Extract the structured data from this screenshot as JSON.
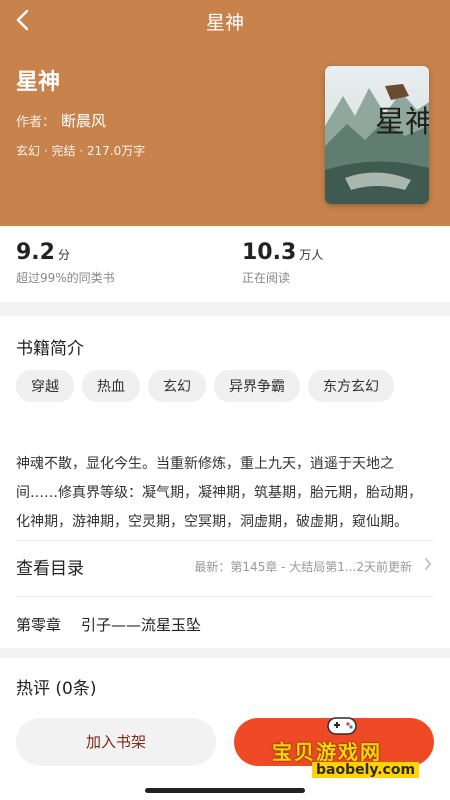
{
  "topbar": {
    "title": "星神"
  },
  "book": {
    "title": "星神",
    "author_label": "作者：",
    "author": "断晨风",
    "meta": "玄幻 · 完结 · 217.0万字",
    "cover_text": "星神"
  },
  "stats": {
    "score": {
      "value": "9.2",
      "unit": "分",
      "sub": "超过99%的同类书"
    },
    "readers": {
      "value": "10.3",
      "unit": "万人",
      "sub": "正在阅读"
    }
  },
  "intro": {
    "title": "书籍简介",
    "tags": [
      "穿越",
      "热血",
      "玄幻",
      "异界争霸",
      "东方玄幻"
    ],
    "text": "神魂不散，显化今生。当重新修炼，重上九天，逍遥于天地之间……修真界等级：凝气期，凝神期，筑基期，胎元期，胎动期，化神期，游神期，空灵期，空冥期，洞虚期，破虚期，窥仙期。"
  },
  "toc": {
    "label": "查看目录",
    "latest": "最新：第145章 - 大结局第1...2天前更新"
  },
  "chapter": {
    "number": "第零章",
    "title": "引子——流星玉坠"
  },
  "comments": {
    "title": "热评 (0条)"
  },
  "bottom": {
    "add_shelf": "加入书架"
  },
  "watermark": {
    "text": "宝贝游戏网",
    "url": "baobely.com"
  },
  "colors": {
    "header": "#c8834c",
    "accent": "#ef4a26"
  }
}
